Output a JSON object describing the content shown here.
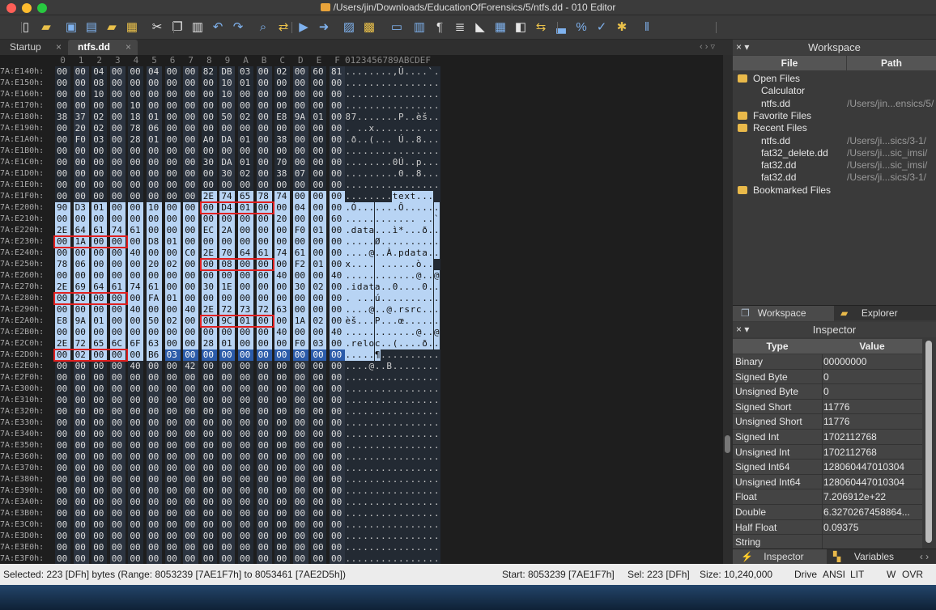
{
  "window": {
    "title": "/Users/jin/Downloads/EducationOfForensics/5/ntfs.dd - 010 Editor"
  },
  "tabs": [
    {
      "label": "Startup",
      "close": "×"
    },
    {
      "label": "ntfs.dd",
      "close": "×"
    }
  ],
  "tab_nav": "‹ › ▿",
  "hex_header": {
    "cols": [
      "0",
      "1",
      "2",
      "3",
      "4",
      "5",
      "6",
      "7",
      "8",
      "9",
      "A",
      "B",
      "C",
      "D",
      "E",
      "F"
    ],
    "ascii": "0123456789ABCDEF"
  },
  "hex_rows": [
    {
      "addr": "7A:E140h:",
      "bytes": "00 00 04 00 00 04 00 00 82 DB 03 00 02 00 60 81",
      "ascii": "........‚Û....`."
    },
    {
      "addr": "7A:E150h:",
      "bytes": "00 00 08 00 00 00 00 00 00 10 01 00 00 00 00 00",
      "ascii": "................"
    },
    {
      "addr": "7A:E160h:",
      "bytes": "00 00 10 00 00 00 00 00 00 10 00 00 00 00 00 00",
      "ascii": "................"
    },
    {
      "addr": "7A:E170h:",
      "bytes": "00 00 00 00 10 00 00 00 00 00 00 00 00 00 00 00",
      "ascii": "................"
    },
    {
      "addr": "7A:E180h:",
      "bytes": "38 37 02 00 18 01 00 00 00 50 02 00 E8 9A 01 00",
      "ascii": "87.......P..èš.."
    },
    {
      "addr": "7A:E190h:",
      "bytes": "00 20 02 00 78 06 00 00 00 00 00 00 00 00 00 00",
      "ascii": ". ..x..........."
    },
    {
      "addr": "7A:E1A0h:",
      "bytes": "00 F0 03 00 28 01 00 00 A0 DA 01 00 38 00 00 00",
      "ascii": ".ð..(... Ú..8..."
    },
    {
      "addr": "7A:E1B0h:",
      "bytes": "00 00 00 00 00 00 00 00 00 00 00 00 00 00 00 00",
      "ascii": "................"
    },
    {
      "addr": "7A:E1C0h:",
      "bytes": "00 00 00 00 00 00 00 00 30 DA 01 00 70 00 00 00",
      "ascii": "........0Ú..p..."
    },
    {
      "addr": "7A:E1D0h:",
      "bytes": "00 00 00 00 00 00 00 00 00 30 02 00 38 07 00 00",
      "ascii": ".........0..8..."
    },
    {
      "addr": "7A:E1E0h:",
      "bytes": "00 00 00 00 00 00 00 00 00 00 00 00 00 00 00 00",
      "ascii": "................"
    },
    {
      "addr": "7A:E1F0h:",
      "bytes": "00 00 00 00 00 00 00 00 2E 74 65 78 74 00 00 00",
      "ascii": "........text..."
    },
    {
      "addr": "7A:E200h:",
      "bytes": "90 D3 01 00 00 10 00 00 00 D4 01 00 00 04 00 00",
      "ascii": ".Ó.......Ô......"
    },
    {
      "addr": "7A:E210h:",
      "bytes": "00 00 00 00 00 00 00 00 00 00 00 00 20 00 00 60",
      "ascii": "............ ..`"
    },
    {
      "addr": "7A:E220h:",
      "bytes": "2E 64 61 74 61 00 00 00 EC 2A 00 00 00 F0 01 00",
      "ascii": ".data...ì*...ð.."
    },
    {
      "addr": "7A:E230h:",
      "bytes": "00 1A 00 00 00 D8 01 00 00 00 00 00 00 00 00 00",
      "ascii": ".....Ø.........."
    },
    {
      "addr": "7A:E240h:",
      "bytes": "00 00 00 00 40 00 00 C0 2E 70 64 61 74 61 00 00",
      "ascii": "....@..À.pdata.."
    },
    {
      "addr": "7A:E250h:",
      "bytes": "78 06 00 00 00 20 02 00 00 08 00 00 00 F2 01 00",
      "ascii": "x.... ......ò.."
    },
    {
      "addr": "7A:E260h:",
      "bytes": "00 00 00 00 00 00 00 00 00 00 00 00 40 00 00 40",
      "ascii": "............@..@"
    },
    {
      "addr": "7A:E270h:",
      "bytes": "2E 69 64 61 74 61 00 00 30 1E 00 00 00 30 02 00",
      "ascii": ".idata..0....0.."
    },
    {
      "addr": "7A:E280h:",
      "bytes": "00 20 00 00 00 FA 01 00 00 00 00 00 00 00 00 00",
      "ascii": ". ...ú.........."
    },
    {
      "addr": "7A:E290h:",
      "bytes": "00 00 00 00 40 00 00 40 2E 72 73 72 63 00 00 00",
      "ascii": "....@..@.rsrc..."
    },
    {
      "addr": "7A:E2A0h:",
      "bytes": "E8 9A 01 00 00 50 02 00 00 9C 01 00 00 1A 02 00",
      "ascii": "èš...P...œ......"
    },
    {
      "addr": "7A:E2B0h:",
      "bytes": "00 00 00 00 00 00 00 00 00 00 00 00 40 00 00 40",
      "ascii": "............@..@"
    },
    {
      "addr": "7A:E2C0h:",
      "bytes": "2E 72 65 6C 6F 63 00 00 28 01 00 00 00 F0 03 00",
      "ascii": ".reloc..(....ð.."
    },
    {
      "addr": "7A:E2D0h:",
      "bytes": "00 02 00 00 00 B6 03 00 00 00 00 00 00 00 00 00",
      "ascii": ".....¶.........."
    },
    {
      "addr": "7A:E2E0h:",
      "bytes": "00 00 00 00 40 00 00 42 00 00 00 00 00 00 00 00",
      "ascii": "....@..B........"
    },
    {
      "addr": "7A:E2F0h:",
      "bytes": "00 00 00 00 00 00 00 00 00 00 00 00 00 00 00 00",
      "ascii": "................"
    },
    {
      "addr": "7A:E300h:",
      "bytes": "00 00 00 00 00 00 00 00 00 00 00 00 00 00 00 00",
      "ascii": "................"
    },
    {
      "addr": "7A:E310h:",
      "bytes": "00 00 00 00 00 00 00 00 00 00 00 00 00 00 00 00",
      "ascii": "................"
    },
    {
      "addr": "7A:E320h:",
      "bytes": "00 00 00 00 00 00 00 00 00 00 00 00 00 00 00 00",
      "ascii": "................"
    },
    {
      "addr": "7A:E330h:",
      "bytes": "00 00 00 00 00 00 00 00 00 00 00 00 00 00 00 00",
      "ascii": "................"
    },
    {
      "addr": "7A:E340h:",
      "bytes": "00 00 00 00 00 00 00 00 00 00 00 00 00 00 00 00",
      "ascii": "................"
    },
    {
      "addr": "7A:E350h:",
      "bytes": "00 00 00 00 00 00 00 00 00 00 00 00 00 00 00 00",
      "ascii": "................"
    },
    {
      "addr": "7A:E360h:",
      "bytes": "00 00 00 00 00 00 00 00 00 00 00 00 00 00 00 00",
      "ascii": "................"
    },
    {
      "addr": "7A:E370h:",
      "bytes": "00 00 00 00 00 00 00 00 00 00 00 00 00 00 00 00",
      "ascii": "................"
    },
    {
      "addr": "7A:E380h:",
      "bytes": "00 00 00 00 00 00 00 00 00 00 00 00 00 00 00 00",
      "ascii": "................"
    },
    {
      "addr": "7A:E390h:",
      "bytes": "00 00 00 00 00 00 00 00 00 00 00 00 00 00 00 00",
      "ascii": "................"
    },
    {
      "addr": "7A:E3A0h:",
      "bytes": "00 00 00 00 00 00 00 00 00 00 00 00 00 00 00 00",
      "ascii": "................"
    },
    {
      "addr": "7A:E3B0h:",
      "bytes": "00 00 00 00 00 00 00 00 00 00 00 00 00 00 00 00",
      "ascii": "................"
    },
    {
      "addr": "7A:E3C0h:",
      "bytes": "00 00 00 00 00 00 00 00 00 00 00 00 00 00 00 00",
      "ascii": "................"
    },
    {
      "addr": "7A:E3D0h:",
      "bytes": "00 00 00 00 00 00 00 00 00 00 00 00 00 00 00 00",
      "ascii": "................"
    },
    {
      "addr": "7A:E3E0h:",
      "bytes": "00 00 00 00 00 00 00 00 00 00 00 00 00 00 00 00",
      "ascii": "................"
    },
    {
      "addr": "7A:E3F0h:",
      "bytes": "00 00 00 00 00 00 00 00 00 00 00 00 00 00 00 00",
      "ascii": "................"
    }
  ],
  "workspace": {
    "title": "Workspace",
    "ctl": "× ▾",
    "col_file": "File",
    "col_path": "Path",
    "items": [
      {
        "name": "Open Files",
        "path": "",
        "indent": 0,
        "icon": "folder-open-icon"
      },
      {
        "name": "Calculator",
        "path": "",
        "indent": 1,
        "icon": ""
      },
      {
        "name": "ntfs.dd",
        "path": "/Users/jin...ensics/5/",
        "indent": 1,
        "icon": ""
      },
      {
        "name": "Favorite Files",
        "path": "",
        "indent": 0,
        "icon": "star-folder-icon"
      },
      {
        "name": "Recent Files",
        "path": "",
        "indent": 0,
        "icon": "recent-folder-icon"
      },
      {
        "name": "ntfs.dd",
        "path": "/Users/ji...sics/3-1/",
        "indent": 1,
        "icon": ""
      },
      {
        "name": "fat32_delete.dd",
        "path": "/Users/ji...sic_imsi/",
        "indent": 1,
        "icon": ""
      },
      {
        "name": "fat32.dd",
        "path": "/Users/ji...sic_imsi/",
        "indent": 1,
        "icon": ""
      },
      {
        "name": "fat32.dd",
        "path": "/Users/ji...sics/3-1/",
        "indent": 1,
        "icon": ""
      },
      {
        "name": "Bookmarked Files",
        "path": "",
        "indent": 0,
        "icon": "bookmark-folder-icon"
      }
    ],
    "tab_workspace": "Workspace",
    "tab_explorer": "Explorer"
  },
  "inspector": {
    "title": "Inspector",
    "ctl": "× ▾",
    "col_type": "Type",
    "col_value": "Value",
    "rows": [
      {
        "type": "Binary",
        "value": "00000000"
      },
      {
        "type": "Signed Byte",
        "value": "0"
      },
      {
        "type": "Unsigned Byte",
        "value": "0"
      },
      {
        "type": "Signed Short",
        "value": "11776"
      },
      {
        "type": "Unsigned Short",
        "value": "11776"
      },
      {
        "type": "Signed Int",
        "value": "1702112768"
      },
      {
        "type": "Unsigned Int",
        "value": "1702112768"
      },
      {
        "type": "Signed Int64",
        "value": "128060447010304"
      },
      {
        "type": "Unsigned Int64",
        "value": "128060447010304"
      },
      {
        "type": "Float",
        "value": "7.206912e+22"
      },
      {
        "type": "Double",
        "value": "6.3270267458864..."
      },
      {
        "type": "Half Float",
        "value": "0.09375"
      },
      {
        "type": "String",
        "value": ""
      }
    ],
    "tab_inspector": "Inspector",
    "tab_variables": "Variables"
  },
  "status": {
    "selected": "Selected: 223 [DFh] bytes (Range: 8053239 [7AE1F7h] to 8053461 [7AE2D5h])",
    "start": "Start: 8053239 [7AE1F7h]",
    "sel": "Sel: 223 [DFh]",
    "size": "Size: 10,240,000",
    "drive": "Drive",
    "encoding": "ANSI",
    "endian": "LIT",
    "mode": "W",
    "ovr": "OVR"
  },
  "toolbar_icons": [
    "new-file-icon",
    "open-folder-icon",
    "save-icon",
    "save-all-icon",
    "open-folder-icon",
    "workspace-icon",
    "cut-icon",
    "copy-icon",
    "paste-icon",
    "undo-icon",
    "redo-icon",
    "find-icon",
    "find-replace-icon",
    "find-in-files-icon",
    "goto-icon",
    "script-icon",
    "template-icon",
    "hex-mode-icon",
    "columns-icon",
    "show-whitespace-icon",
    "list-icon",
    "highlight-icon",
    "calculator-icon",
    "compare-icon",
    "swap-icon",
    "histogram-icon",
    "percent-icon",
    "checksum-icon",
    "run-template-icon",
    "pause-icon"
  ],
  "colors": {
    "selection": "#b8d4f4",
    "cursor": "#2b5ba9",
    "red_box": "#e02020"
  },
  "selection": {
    "start_offset": "7AE1F7h",
    "end_offset": "7AE2D5h"
  }
}
